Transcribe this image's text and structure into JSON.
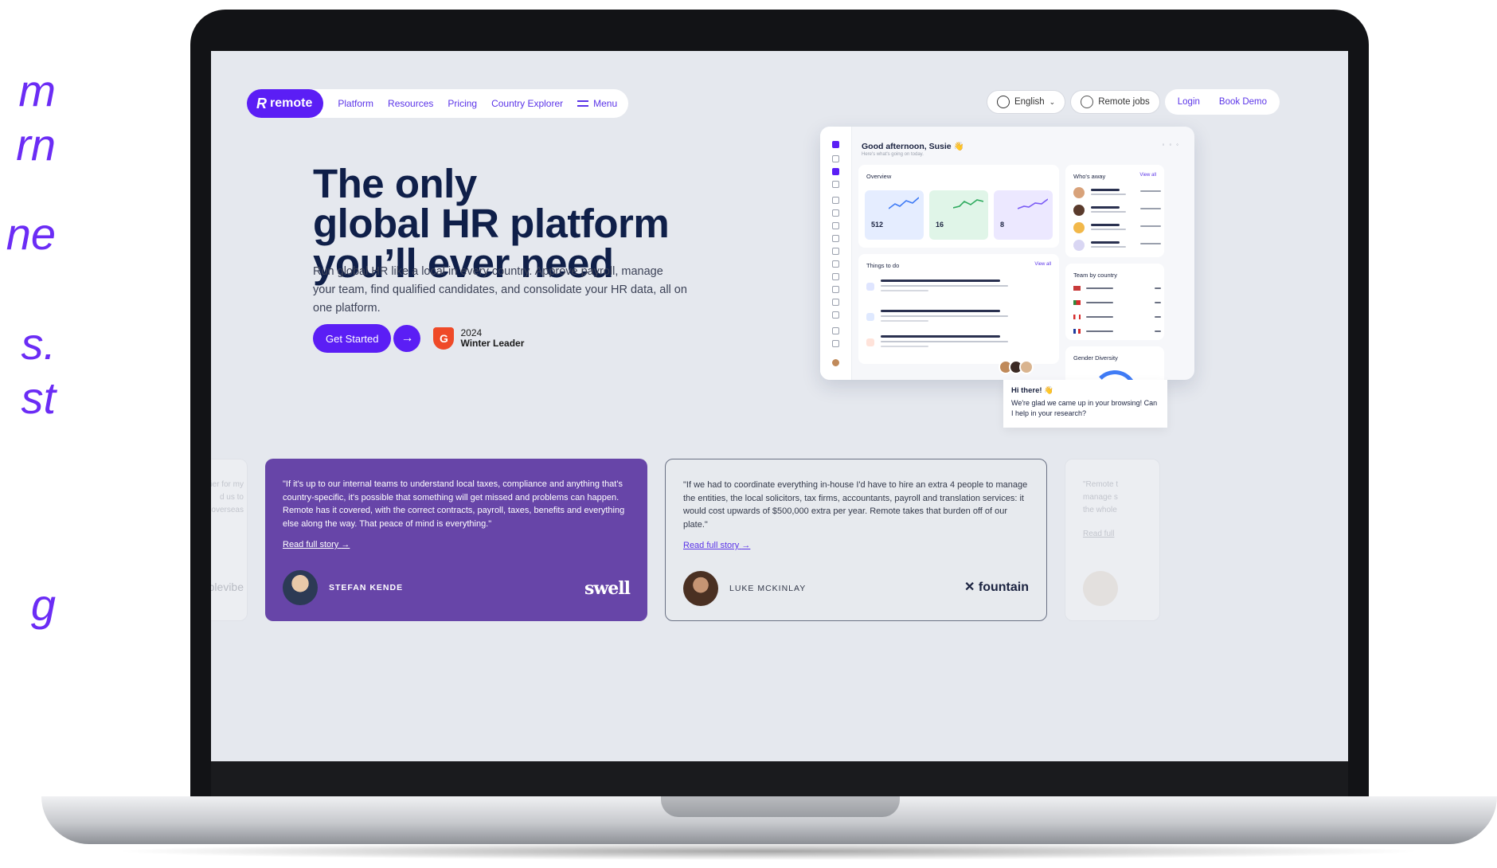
{
  "side_text": [
    "m",
    "rn",
    "ne",
    "s.",
    "st",
    "g"
  ],
  "nav": {
    "logo": "remote",
    "links": [
      "Platform",
      "Resources",
      "Pricing",
      "Country Explorer"
    ],
    "menu_label": "Menu",
    "language": "English",
    "remote_jobs": "Remote jobs",
    "login": "Login",
    "book_demo": "Book Demo"
  },
  "hero": {
    "headline": [
      "The only",
      "global HR platform",
      "you’ll ever need"
    ],
    "subtitle": "Run global HR like a local in every country. Approve payroll, manage your team, find qualified candidates, and consolidate your HR data, all on one platform.",
    "cta_label": "Get Started",
    "badge_year": "2024",
    "badge_title": "Winter Leader"
  },
  "dashboard": {
    "greeting": "Good afternoon, Susie 👋",
    "greeting_sub": "Here's what's going on today.",
    "overview": "Overview",
    "tiles": [
      {
        "value": "512",
        "color": "#e5edff"
      },
      {
        "value": "16",
        "color": "#e0f5e8"
      },
      {
        "value": "8",
        "color": "#ece8ff"
      }
    ],
    "things_to_do": "Things to do",
    "view_all": "View all",
    "whos_away": "Who's away",
    "team_by_country": "Team by country",
    "gender_diversity": "Gender Diversity"
  },
  "chat": {
    "title": "Hi there! 👋",
    "body": "We're glad we came up in your browsing! Can I help in your research?"
  },
  "testimonials": [
    {
      "quote": "\"If it's up to our internal teams to understand local taxes, compliance and anything that's country-specific, it's possible that something will get missed and problems can happen. Remote has it covered, with the correct contracts, payroll, taxes, benefits and everything else along the way. That peace of mind is everything.\"",
      "read_more": "Read full story",
      "name": "STEFAN KENDE",
      "brand": "swell"
    },
    {
      "quote": "\"If we had to coordinate everything in-house I'd have to hire an extra 4 people to manage the entities, the local solicitors, tax firms, accountants, payroll and translation services: it would cost upwards of $500,000 extra per year. Remote takes that burden off of our plate.\"",
      "read_more": "Read full story",
      "name": "LUKE MCKINLAY",
      "brand": "fountain"
    }
  ],
  "ghost_cards": {
    "left_lines": [
      "sier for my",
      "d us to",
      "overseas"
    ],
    "left_brand": "Tablevibe",
    "right_lines": [
      "\"Remote t",
      "manage s",
      "the whole"
    ],
    "right_link": "Read full"
  },
  "colors": {
    "brand": "#5b1ef5",
    "navy": "#0f1f49",
    "testimonial_purple": "#6745a8"
  }
}
